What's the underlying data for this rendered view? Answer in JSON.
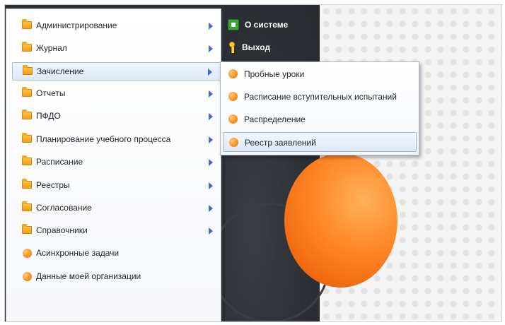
{
  "main_menu": {
    "items": [
      {
        "label": "Администрирование",
        "icon": "folder-icon",
        "has_submenu": true
      },
      {
        "label": "Журнал",
        "icon": "folder-icon",
        "has_submenu": true
      },
      {
        "label": "Зачисление",
        "icon": "folder-icon",
        "has_submenu": true,
        "active": true
      },
      {
        "label": "Отчеты",
        "icon": "folder-icon",
        "has_submenu": true
      },
      {
        "label": "ПФДО",
        "icon": "folder-icon",
        "has_submenu": true
      },
      {
        "label": "Планирование учебного процесса",
        "icon": "folder-icon",
        "has_submenu": true
      },
      {
        "label": "Расписание",
        "icon": "folder-icon",
        "has_submenu": true
      },
      {
        "label": "Реестры",
        "icon": "folder-icon",
        "has_submenu": true
      },
      {
        "label": "Согласование",
        "icon": "folder-icon",
        "has_submenu": true
      },
      {
        "label": "Справочники",
        "icon": "folder-icon",
        "has_submenu": true
      },
      {
        "label": "Асинхронные задачи",
        "icon": "orange-dot-icon",
        "has_submenu": false
      },
      {
        "label": "Данные моей организации",
        "icon": "orange-dot-icon",
        "has_submenu": false
      }
    ]
  },
  "top_menu": {
    "about": {
      "label": "О системе",
      "icon": "monitor-icon"
    },
    "logout": {
      "label": "Выход",
      "icon": "key-icon"
    }
  },
  "submenu": {
    "parent": "Зачисление",
    "items": [
      {
        "label": "Пробные уроки",
        "icon": "orange-dot-icon"
      },
      {
        "label": "Расписание вступительных испытаний",
        "icon": "orange-dot-icon"
      },
      {
        "label": "Распределение",
        "icon": "orange-dot-icon"
      },
      {
        "label": "Реестр заявлений",
        "icon": "orange-dot-icon",
        "active": true
      }
    ]
  },
  "colors": {
    "accent": "#3a6fd6",
    "folder": "#f29a10",
    "dot": "#ff9b2f",
    "dark_panel": "#2b2e33"
  }
}
